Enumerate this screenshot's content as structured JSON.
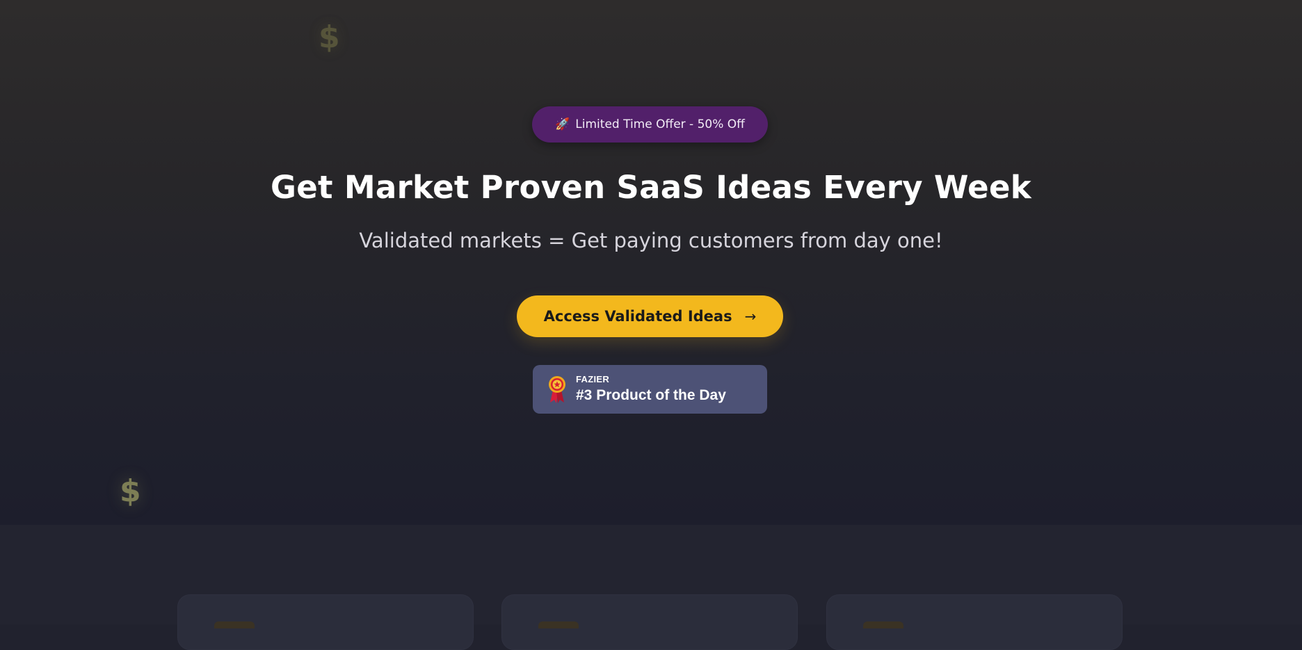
{
  "offer_badge": {
    "icon": "rocket-icon",
    "text": "Limited Time Offer - 50% Off"
  },
  "hero": {
    "title": "Get Market Proven SaaS Ideas Every Week",
    "subtitle": "Validated markets = Get paying customers from day one!"
  },
  "cta": {
    "label": "Access Validated Ideas",
    "icon": "arrow-right-icon"
  },
  "award": {
    "icon": "medal-icon",
    "brand": "FAZIER",
    "rank": "#3 Product of the Day"
  },
  "decorations": {
    "symbol": "$"
  },
  "colors": {
    "accent": "#f3b81d",
    "offer_badge_bg": "#52206a",
    "award_badge_bg": "#4d5276",
    "background_top": "#2e2c2c",
    "background_bottom": "#1d1e2c"
  }
}
